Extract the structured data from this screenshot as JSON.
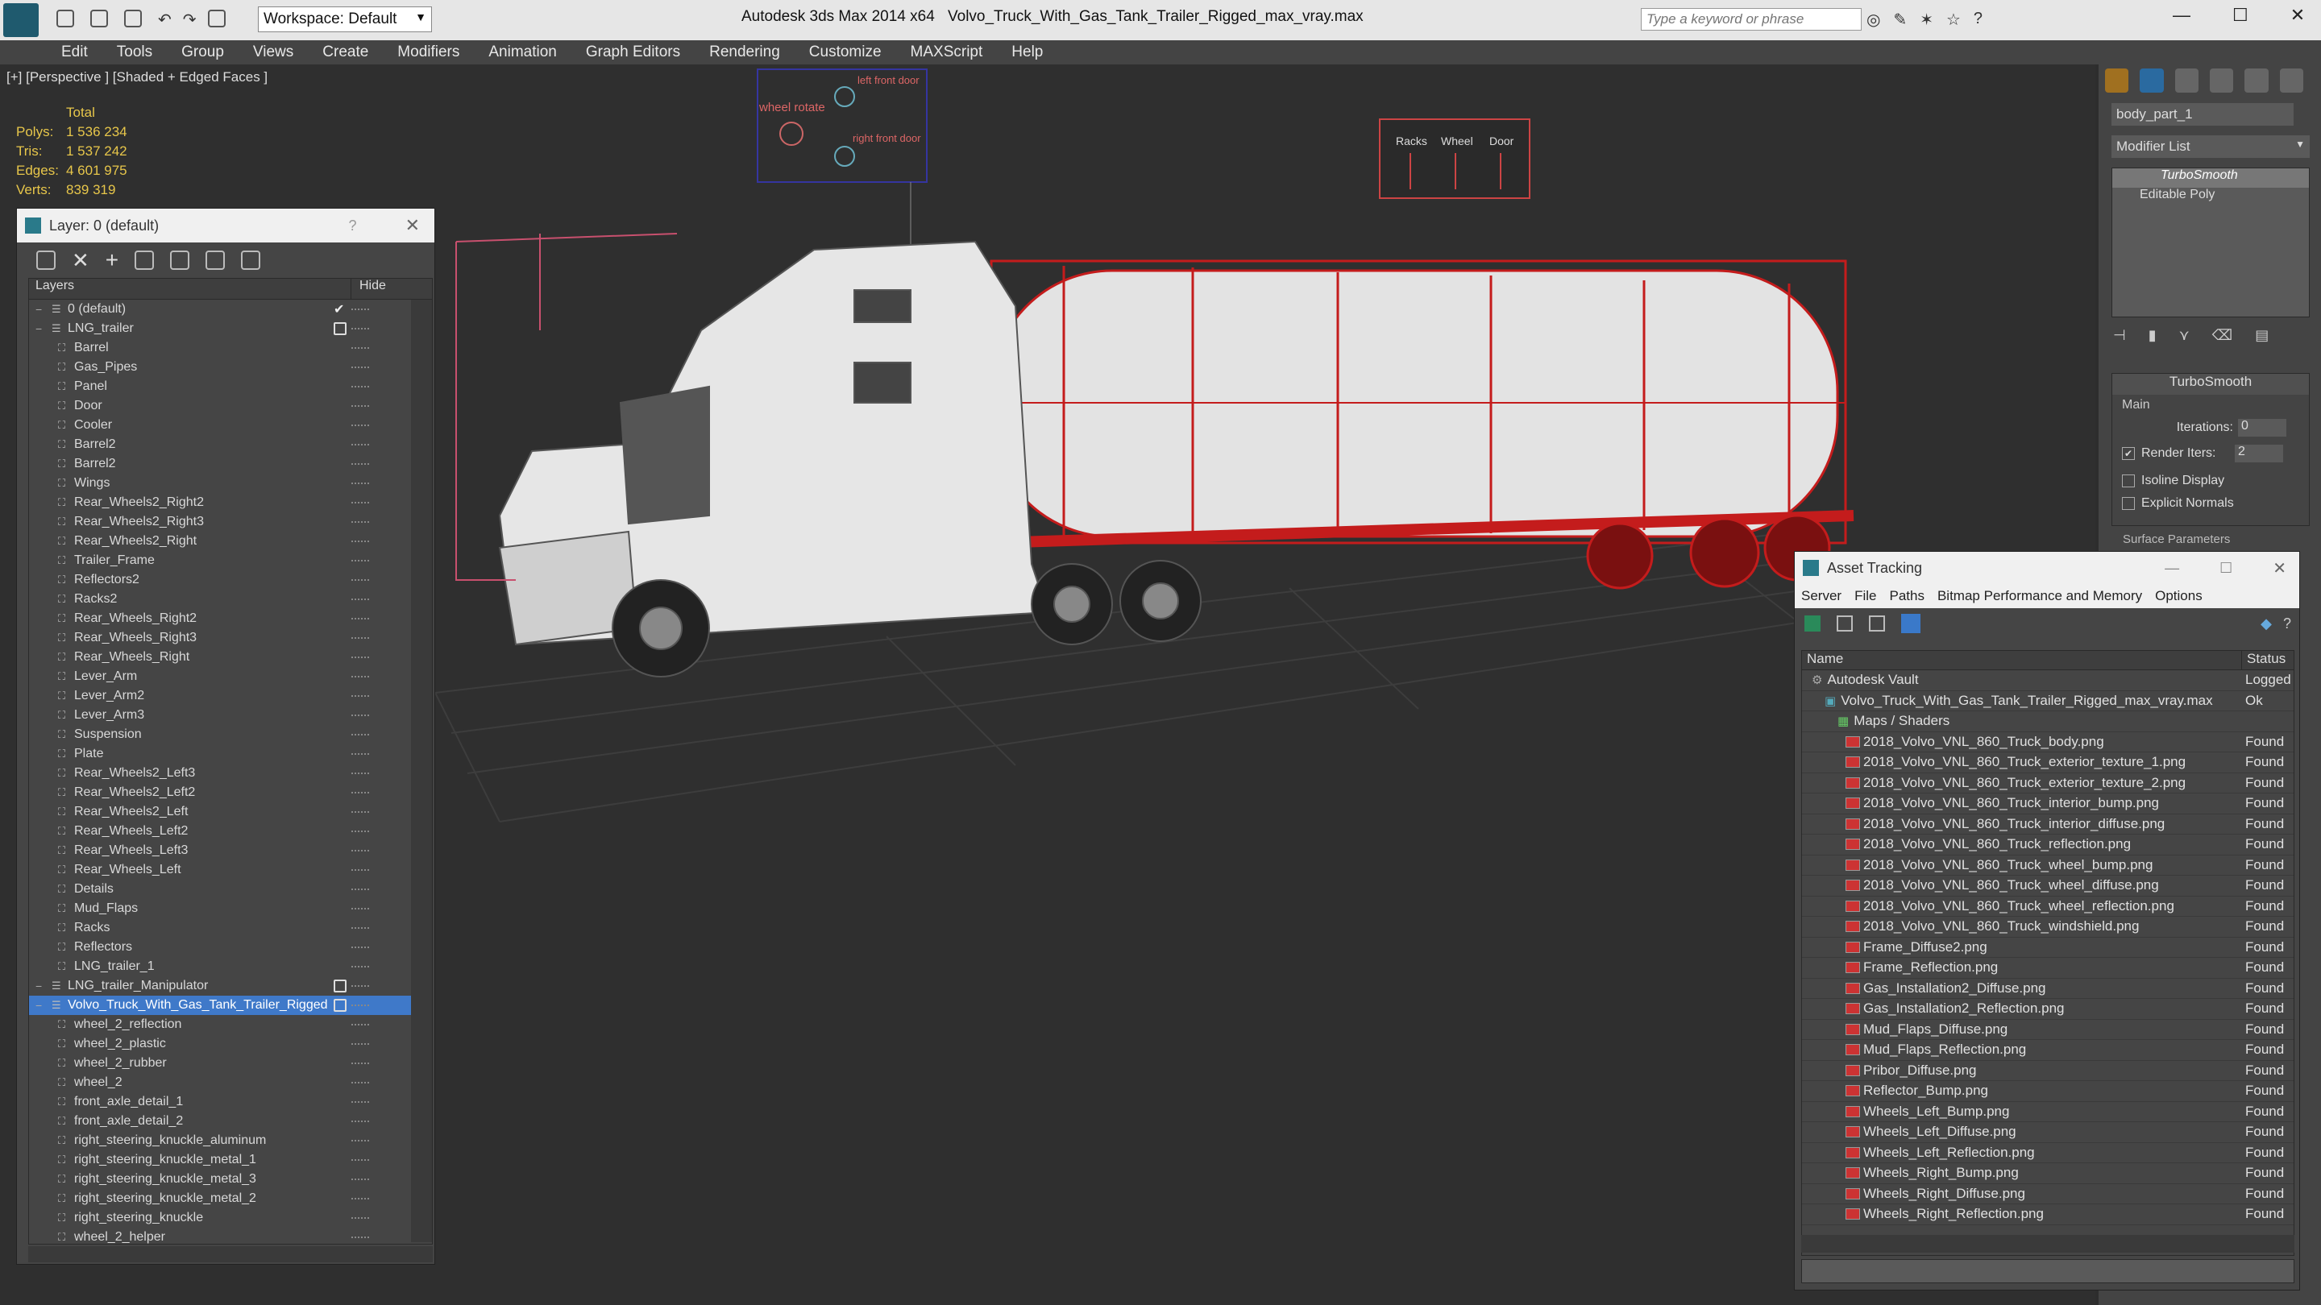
{
  "titlebar": {
    "workspace": "Workspace: Default",
    "app_title": "Autodesk 3ds Max  2014 x64",
    "file_title": "Volvo_Truck_With_Gas_Tank_Trailer_Rigged_max_vray.max",
    "search_placeholder": "Type a keyword or phrase"
  },
  "menu": [
    "Edit",
    "Tools",
    "Group",
    "Views",
    "Create",
    "Modifiers",
    "Animation",
    "Graph Editors",
    "Rendering",
    "Customize",
    "MAXScript",
    "Help"
  ],
  "viewport": {
    "label": "[+] [Perspective ] [Shaded + Edged Faces ]",
    "stats_header": "Total",
    "stats": [
      {
        "k": "Polys:",
        "v": "1 536 234"
      },
      {
        "k": "Tris:",
        "v": "1 537 242"
      },
      {
        "k": "Edges:",
        "v": "4 601 975"
      },
      {
        "k": "Verts:",
        "v": "839 319"
      }
    ],
    "rig_labels": {
      "wheel_rotate": "wheel rotate",
      "left_front_door": "left front door",
      "right_front_door": "right front door"
    },
    "sliders": [
      "Racks",
      "Wheel",
      "Door"
    ]
  },
  "layer_panel": {
    "title": "Layer: 0 (default)",
    "help": "?",
    "col_layers": "Layers",
    "col_hide": "Hide",
    "rows": [
      {
        "label": "0 (default)",
        "indent": 1,
        "type": "layer",
        "check": true
      },
      {
        "label": "LNG_trailer",
        "indent": 1,
        "type": "layer",
        "box": true
      },
      {
        "label": "Barrel",
        "indent": 2
      },
      {
        "label": "Gas_Pipes",
        "indent": 2
      },
      {
        "label": "Panel",
        "indent": 2
      },
      {
        "label": "Door",
        "indent": 2
      },
      {
        "label": "Cooler",
        "indent": 2
      },
      {
        "label": "Barrel2",
        "indent": 2
      },
      {
        "label": "Barrel2",
        "indent": 2
      },
      {
        "label": "Wings",
        "indent": 2
      },
      {
        "label": "Rear_Wheels2_Right2",
        "indent": 2
      },
      {
        "label": "Rear_Wheels2_Right3",
        "indent": 2
      },
      {
        "label": "Rear_Wheels2_Right",
        "indent": 2
      },
      {
        "label": "Trailer_Frame",
        "indent": 2
      },
      {
        "label": "Reflectors2",
        "indent": 2
      },
      {
        "label": "Racks2",
        "indent": 2
      },
      {
        "label": "Rear_Wheels_Right2",
        "indent": 2
      },
      {
        "label": "Rear_Wheels_Right3",
        "indent": 2
      },
      {
        "label": "Rear_Wheels_Right",
        "indent": 2
      },
      {
        "label": "Lever_Arm",
        "indent": 2
      },
      {
        "label": "Lever_Arm2",
        "indent": 2
      },
      {
        "label": "Lever_Arm3",
        "indent": 2
      },
      {
        "label": "Suspension",
        "indent": 2
      },
      {
        "label": "Plate",
        "indent": 2
      },
      {
        "label": "Rear_Wheels2_Left3",
        "indent": 2
      },
      {
        "label": "Rear_Wheels2_Left2",
        "indent": 2
      },
      {
        "label": "Rear_Wheels2_Left",
        "indent": 2
      },
      {
        "label": "Rear_Wheels_Left2",
        "indent": 2
      },
      {
        "label": "Rear_Wheels_Left3",
        "indent": 2
      },
      {
        "label": "Rear_Wheels_Left",
        "indent": 2
      },
      {
        "label": "Details",
        "indent": 2
      },
      {
        "label": "Mud_Flaps",
        "indent": 2
      },
      {
        "label": "Racks",
        "indent": 2
      },
      {
        "label": "Reflectors",
        "indent": 2
      },
      {
        "label": "LNG_trailer_1",
        "indent": 2
      },
      {
        "label": "LNG_trailer_Manipulator",
        "indent": 1,
        "type": "layer",
        "box": true
      },
      {
        "label": "Volvo_Truck_With_Gas_Tank_Trailer_Rigged",
        "indent": 1,
        "type": "layer",
        "box": true,
        "selected": true
      },
      {
        "label": "wheel_2_reflection",
        "indent": 2
      },
      {
        "label": "wheel_2_plastic",
        "indent": 2
      },
      {
        "label": "wheel_2_rubber",
        "indent": 2
      },
      {
        "label": "wheel_2",
        "indent": 2
      },
      {
        "label": "front_axle_detail_1",
        "indent": 2
      },
      {
        "label": "front_axle_detail_2",
        "indent": 2
      },
      {
        "label": "right_steering_knuckle_aluminum",
        "indent": 2
      },
      {
        "label": "right_steering_knuckle_metal_1",
        "indent": 2
      },
      {
        "label": "right_steering_knuckle_metal_3",
        "indent": 2
      },
      {
        "label": "right_steering_knuckle_metal_2",
        "indent": 2
      },
      {
        "label": "right_steering_knuckle",
        "indent": 2
      },
      {
        "label": "wheel_2_helper",
        "indent": 2
      }
    ]
  },
  "command_panel": {
    "object_name": "body_part_1",
    "modifier_list": "Modifier List",
    "stack": [
      "TurboSmooth",
      "Editable Poly"
    ],
    "rollout_title": "TurboSmooth",
    "group_main": "Main",
    "iterations_label": "Iterations:",
    "iterations_value": "0",
    "render_iters_label": "Render Iters:",
    "render_iters_value": "2",
    "isoline": "Isoline Display",
    "explicit": "Explicit Normals",
    "surface": "Surface Parameters"
  },
  "asset_tracking": {
    "title": "Asset Tracking",
    "menu": [
      "Server",
      "File",
      "Paths",
      "Bitmap Performance and Memory",
      "Options"
    ],
    "col_name": "Name",
    "col_status": "Status",
    "rows": [
      {
        "name": "Autodesk Vault",
        "status": "Logged",
        "level": 0
      },
      {
        "name": "Volvo_Truck_With_Gas_Tank_Trailer_Rigged_max_vray.max",
        "status": "Ok",
        "level": 1
      },
      {
        "name": "Maps / Shaders",
        "status": "",
        "level": 2
      },
      {
        "name": "2018_Volvo_VNL_860_Truck_body.png",
        "status": "Found",
        "level": 3
      },
      {
        "name": "2018_Volvo_VNL_860_Truck_exterior_texture_1.png",
        "status": "Found",
        "level": 3
      },
      {
        "name": "2018_Volvo_VNL_860_Truck_exterior_texture_2.png",
        "status": "Found",
        "level": 3
      },
      {
        "name": "2018_Volvo_VNL_860_Truck_interior_bump.png",
        "status": "Found",
        "level": 3
      },
      {
        "name": "2018_Volvo_VNL_860_Truck_interior_diffuse.png",
        "status": "Found",
        "level": 3
      },
      {
        "name": "2018_Volvo_VNL_860_Truck_reflection.png",
        "status": "Found",
        "level": 3
      },
      {
        "name": "2018_Volvo_VNL_860_Truck_wheel_bump.png",
        "status": "Found",
        "level": 3
      },
      {
        "name": "2018_Volvo_VNL_860_Truck_wheel_diffuse.png",
        "status": "Found",
        "level": 3
      },
      {
        "name": "2018_Volvo_VNL_860_Truck_wheel_reflection.png",
        "status": "Found",
        "level": 3
      },
      {
        "name": "2018_Volvo_VNL_860_Truck_windshield.png",
        "status": "Found",
        "level": 3
      },
      {
        "name": "Frame_Diffuse2.png",
        "status": "Found",
        "level": 3
      },
      {
        "name": "Frame_Reflection.png",
        "status": "Found",
        "level": 3
      },
      {
        "name": "Gas_Installation2_Diffuse.png",
        "status": "Found",
        "level": 3
      },
      {
        "name": "Gas_Installation2_Reflection.png",
        "status": "Found",
        "level": 3
      },
      {
        "name": "Mud_Flaps_Diffuse.png",
        "status": "Found",
        "level": 3
      },
      {
        "name": "Mud_Flaps_Reflection.png",
        "status": "Found",
        "level": 3
      },
      {
        "name": "Pribor_Diffuse.png",
        "status": "Found",
        "level": 3
      },
      {
        "name": "Reflector_Bump.png",
        "status": "Found",
        "level": 3
      },
      {
        "name": "Wheels_Left_Bump.png",
        "status": "Found",
        "level": 3
      },
      {
        "name": "Wheels_Left_Diffuse.png",
        "status": "Found",
        "level": 3
      },
      {
        "name": "Wheels_Left_Reflection.png",
        "status": "Found",
        "level": 3
      },
      {
        "name": "Wheels_Right_Bump.png",
        "status": "Found",
        "level": 3
      },
      {
        "name": "Wheels_Right_Diffuse.png",
        "status": "Found",
        "level": 3
      },
      {
        "name": "Wheels_Right_Reflection.png",
        "status": "Found",
        "level": 3
      }
    ]
  }
}
